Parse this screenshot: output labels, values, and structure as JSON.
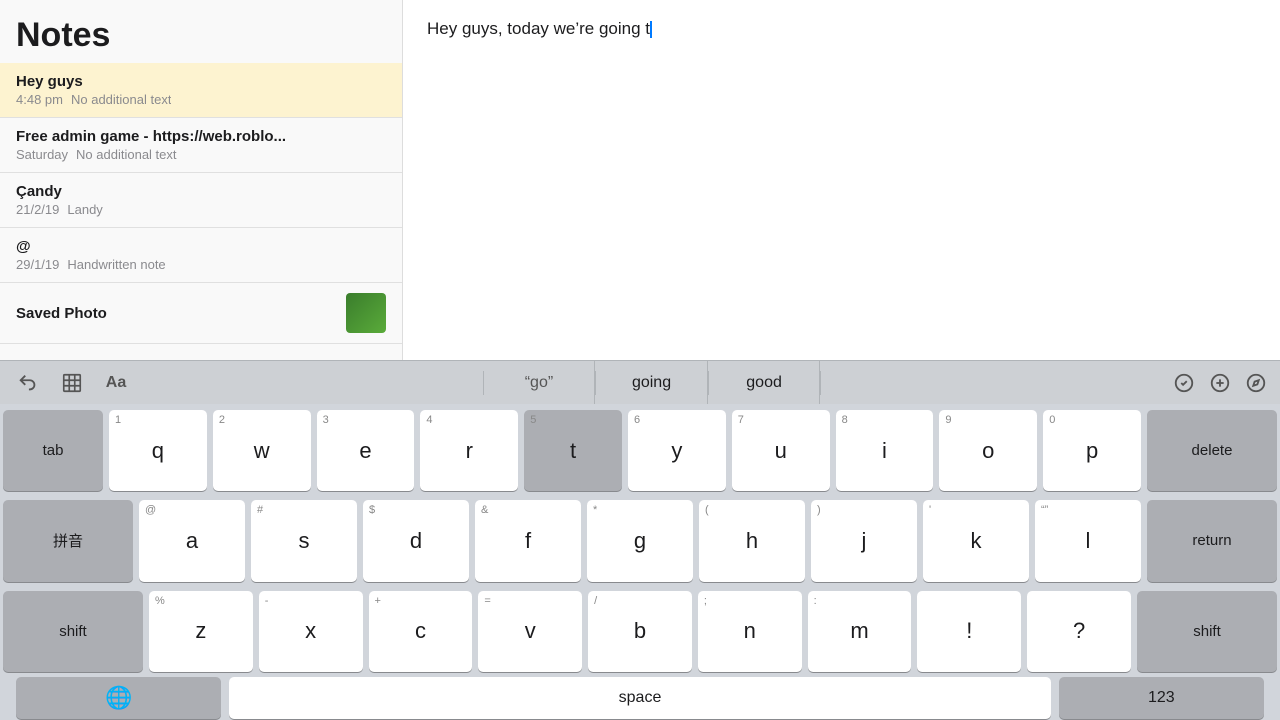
{
  "sidebar": {
    "title": "Notes",
    "notes": [
      {
        "id": "hey-guys",
        "title": "Hey guys",
        "date": "4:48 pm",
        "preview": "No additional text",
        "selected": true,
        "hasThumb": false
      },
      {
        "id": "free-admin",
        "title": "Free admin game - https://web.roblo...",
        "date": "Saturday",
        "preview": "No additional text",
        "selected": false,
        "hasThumb": false
      },
      {
        "id": "candy",
        "title": "Çandy",
        "date": "21/2/19",
        "preview": "Landy",
        "selected": false,
        "hasThumb": false
      },
      {
        "id": "at",
        "title": "@",
        "date": "29/1/19",
        "preview": "Handwritten note",
        "selected": false,
        "hasThumb": false
      },
      {
        "id": "saved-photo",
        "title": "Saved Photo",
        "date": "",
        "preview": "",
        "selected": false,
        "hasThumb": true
      }
    ]
  },
  "main": {
    "note_text": "Hey guys, today we’re going t"
  },
  "autocomplete": {
    "items": [
      {
        "label": "“go”",
        "quoted": true
      },
      {
        "label": "going",
        "quoted": false
      },
      {
        "label": "good",
        "quoted": false
      }
    ]
  },
  "toolbar": {
    "undo_icon": "↩",
    "table_icon": "⊡",
    "format_icon": "Aa"
  },
  "keyboard": {
    "row1": [
      {
        "char": "q",
        "num": "1"
      },
      {
        "char": "w",
        "num": "2"
      },
      {
        "char": "e",
        "num": "3"
      },
      {
        "char": "r",
        "num": "4"
      },
      {
        "char": "t",
        "num": "5",
        "active": true
      },
      {
        "char": "y",
        "num": "6"
      },
      {
        "char": "u",
        "num": "7"
      },
      {
        "char": "i",
        "num": "8"
      },
      {
        "char": "o",
        "num": "9"
      },
      {
        "char": "p",
        "num": "0"
      }
    ],
    "row2": [
      {
        "char": "a",
        "sym": "@"
      },
      {
        "char": "s",
        "sym": "#"
      },
      {
        "char": "d",
        "sym": "$"
      },
      {
        "char": "f",
        "sym": "&"
      },
      {
        "char": "g",
        "sym": "*"
      },
      {
        "char": "h",
        "sym": "("
      },
      {
        "char": "j",
        "sym": ")"
      },
      {
        "char": "k",
        "sym": "'"
      },
      {
        "char": "l",
        "sym": "“”"
      }
    ],
    "row3": [
      {
        "char": "z",
        "sym": "%"
      },
      {
        "char": "x",
        "sym": "-"
      },
      {
        "char": "c",
        "sym": "+"
      },
      {
        "char": "v",
        "sym": "="
      },
      {
        "char": "b",
        "sym": "/"
      },
      {
        "char": "n",
        "sym": ";"
      },
      {
        "char": "m",
        "sym": ":"
      }
    ],
    "special": {
      "tab": "tab",
      "delete": "delete",
      "pinyin": "拼音",
      "return": "return",
      "shift_left": "shift",
      "shift_right": "shift",
      "exclaim": "!",
      "question": "?",
      "comma": ",",
      "period": "."
    },
    "bottom": {
      "space": "space",
      "num_label": "123"
    }
  }
}
